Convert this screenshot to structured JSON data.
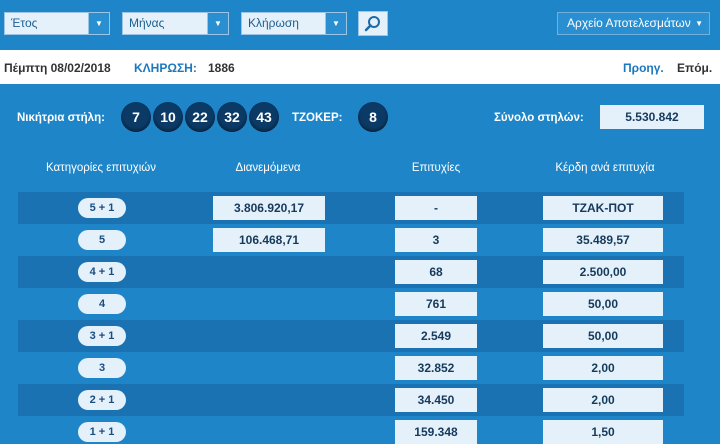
{
  "filters": {
    "year_label": "Έτος",
    "month_label": "Μήνας",
    "draw_label": "Κλήρωση",
    "archive_label": "Αρχείο Αποτελεσμάτων"
  },
  "info": {
    "date": "Πέμπτη 08/02/2018",
    "draw_label": "ΚΛΗΡΩΣΗ:",
    "draw_number": "1886",
    "prev_label": "Προηγ.",
    "next_label": "Επόμ."
  },
  "winning": {
    "label": "Νικήτρια στήλη:",
    "numbers": [
      "7",
      "10",
      "22",
      "32",
      "43"
    ],
    "joker_label": "ΤΖΟΚΕΡ:",
    "joker": "8",
    "total_label": "Σύνολο στηλών:",
    "total": "5.530.842"
  },
  "table": {
    "headers": [
      "Κατηγορίες επιτυχιών",
      "Διανεμόμενα",
      "Επιτυχίες",
      "Κέρδη ανά επιτυχία"
    ],
    "rows": [
      {
        "category": "5 + 1",
        "distributed": "3.806.920,17",
        "winners": "-",
        "prize": "ΤΖΑΚ-ΠΟΤ"
      },
      {
        "category": "5",
        "distributed": "106.468,71",
        "winners": "3",
        "prize": "35.489,57"
      },
      {
        "category": "4 + 1",
        "distributed": "",
        "winners": "68",
        "prize": "2.500,00"
      },
      {
        "category": "4",
        "distributed": "",
        "winners": "761",
        "prize": "50,00"
      },
      {
        "category": "3 + 1",
        "distributed": "",
        "winners": "2.549",
        "prize": "50,00"
      },
      {
        "category": "3",
        "distributed": "",
        "winners": "32.852",
        "prize": "2,00"
      },
      {
        "category": "2 + 1",
        "distributed": "",
        "winners": "34.450",
        "prize": "2,00"
      },
      {
        "category": "1 + 1",
        "distributed": "",
        "winners": "159.348",
        "prize": "1,50"
      }
    ]
  }
}
